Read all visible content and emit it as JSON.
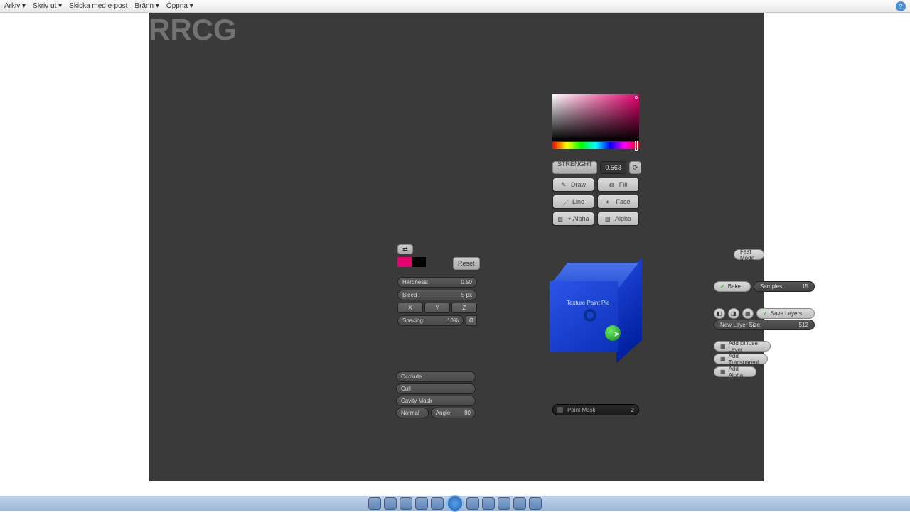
{
  "menubar": {
    "items": [
      "Arkiv ▾",
      "Skriv ut ▾",
      "Skicka med e-post",
      "Bränn ▾",
      "Öppna ▾"
    ]
  },
  "watermark": {
    "rrcg": "RRCG"
  },
  "colorpicker": {
    "strength_label": "STRENGHT :",
    "strength_value": "0.563",
    "tools": {
      "draw": "Draw",
      "fill": "Fill",
      "line": "Line",
      "face": "Face",
      "plus_alpha": "+ Alpha",
      "alpha": "Alpha"
    }
  },
  "left": {
    "reset": "Reset",
    "hardness": {
      "label": "Hardness:",
      "value": "0.50"
    },
    "bleed": {
      "label": "Bleed :",
      "value": "5 px"
    },
    "axes": {
      "x": "X",
      "y": "Y",
      "z": "Z"
    },
    "spacing": {
      "label": "Spacing:",
      "value": "10%"
    },
    "occlude": "Occlude",
    "cull": "Cull",
    "cavity": "Cavity Mask",
    "normal": "Normal",
    "angle": {
      "label": "Angle:",
      "value": "80"
    }
  },
  "cube": {
    "label": "Texture Paint Pie"
  },
  "paintmask": {
    "label": "Paint Mask",
    "count": "2"
  },
  "right": {
    "fastmode": "Fast Mode",
    "bake": "Bake",
    "samples": {
      "label": "Samples:",
      "value": "15"
    },
    "save_layers": "Save  Layers",
    "new_layer_size": {
      "label": "New Layer Size:",
      "value": "512"
    },
    "add_diffuse": "Add Diffuse Layer",
    "add_transparent": "Add Transparent",
    "add_alpha": "Add Alpha"
  }
}
